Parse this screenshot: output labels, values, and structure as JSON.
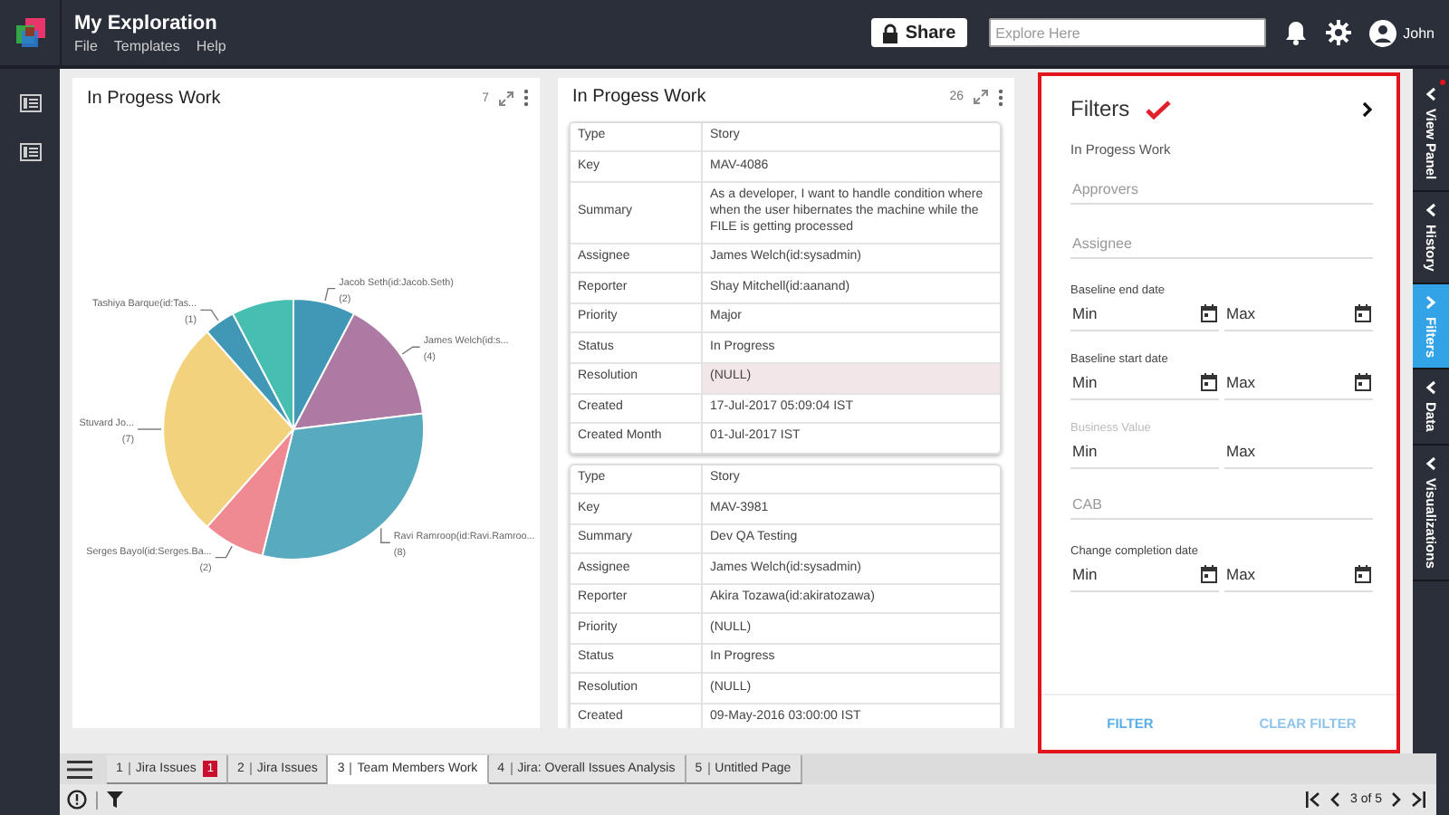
{
  "app": {
    "title": "My Exploration",
    "menu": [
      "File",
      "Templates",
      "Help"
    ],
    "share_button": "Share",
    "search": {
      "placeholder": "Explore Here"
    },
    "user": "John"
  },
  "chart_panel": {
    "title": "In Progess Work",
    "count": "7",
    "chart_data": {
      "type": "pie",
      "categories": [
        "Jacob Seth(id:Jacob.Seth)",
        "James Welch(id:s...",
        "Ravi Ramroop(id:Ravi.Ramroo...",
        "Serges Bayol(id:Serges.Ba...",
        "Stuvard Jo...",
        "Tashiya Barque(id:Tas...",
        null
      ],
      "values": [
        2,
        4,
        8,
        2,
        7,
        1,
        2
      ],
      "value_labels": [
        "(2)",
        "(4)",
        "(8)",
        "(2)",
        "(7)",
        "(1)",
        null
      ],
      "colors": [
        "#4198b6",
        "#ad7aa3",
        "#58aabf",
        "#ef8a93",
        "#f2d27d",
        "#4198b6",
        "#47bfb0"
      ]
    }
  },
  "table_panel": {
    "title": "In Progess Work",
    "count": "26",
    "records": [
      {
        "rows": [
          {
            "field": "Type",
            "value": "Story",
            "highlighted": false
          },
          {
            "field": "Key",
            "value": "MAV-4086",
            "highlighted": false
          },
          {
            "field": "Summary",
            "value": "As a developer, I want to handle condition where when the user hibernates the machine while the FILE is getting processed",
            "highlighted": false
          },
          {
            "field": "Assignee",
            "value": "James Welch(id:sysadmin)",
            "highlighted": false
          },
          {
            "field": "Reporter",
            "value": "Shay Mitchell(id:aanand)",
            "highlighted": false
          },
          {
            "field": "Priority",
            "value": "Major",
            "highlighted": false
          },
          {
            "field": "Status",
            "value": "In Progress",
            "highlighted": false
          },
          {
            "field": "Resolution",
            "value": "(NULL)",
            "highlighted": true
          },
          {
            "field": "Created",
            "value": "17-Jul-2017 05:09:04 IST",
            "highlighted": false
          },
          {
            "field": "Created Month",
            "value": "01-Jul-2017 IST",
            "highlighted": false
          }
        ]
      },
      {
        "rows": [
          {
            "field": "Type",
            "value": "Story",
            "highlighted": false
          },
          {
            "field": "Key",
            "value": "MAV-3981",
            "highlighted": false
          },
          {
            "field": "Summary",
            "value": "Dev QA Testing",
            "highlighted": false
          },
          {
            "field": "Assignee",
            "value": "James Welch(id:sysadmin)",
            "highlighted": false
          },
          {
            "field": "Reporter",
            "value": "Akira Tozawa(id:akiratozawa)",
            "highlighted": false
          },
          {
            "field": "Priority",
            "value": "(NULL)",
            "highlighted": false
          },
          {
            "field": "Status",
            "value": "In Progress",
            "highlighted": false
          },
          {
            "field": "Resolution",
            "value": "(NULL)",
            "highlighted": false
          },
          {
            "field": "Created",
            "value": "09-May-2016 03:00:00 IST",
            "highlighted": false
          }
        ]
      }
    ]
  },
  "filters": {
    "title": "Filters",
    "subtitle": "In Progess Work",
    "fields": [
      {
        "kind": "text",
        "placeholder": "Approvers"
      },
      {
        "kind": "text",
        "placeholder": "Assignee"
      },
      {
        "kind": "date_range",
        "label": "Baseline end date",
        "disabled": false,
        "min_placeholder": "Min",
        "max_placeholder": "Max"
      },
      {
        "kind": "date_range",
        "label": "Baseline start date",
        "disabled": false,
        "min_placeholder": "Min",
        "max_placeholder": "Max"
      },
      {
        "kind": "number_range",
        "label": "Business Value",
        "disabled": true,
        "min_placeholder": "Min",
        "max_placeholder": "Max"
      },
      {
        "kind": "text",
        "placeholder": "CAB"
      },
      {
        "kind": "date_range",
        "label": "Change completion date",
        "disabled": false,
        "min_placeholder": "Min",
        "max_placeholder": "Max"
      }
    ],
    "buttons": [
      {
        "label": "FILTER",
        "disabled": false
      },
      {
        "label": "CLEAR FILTER",
        "disabled": true
      }
    ]
  },
  "side_tabs": [
    {
      "label": "View Panel",
      "selected": false,
      "notification": true
    },
    {
      "label": "History",
      "selected": false,
      "notification": false
    },
    {
      "label": "Filters",
      "selected": true,
      "notification": false
    },
    {
      "label": "Data",
      "selected": false,
      "notification": false
    },
    {
      "label": "Visualizations",
      "selected": false,
      "notification": false
    }
  ],
  "page_tabs": [
    {
      "number": "1",
      "label": "Jira Issues",
      "badge": "1",
      "selected": false
    },
    {
      "number": "2",
      "label": "Jira Issues",
      "selected": false
    },
    {
      "number": "3",
      "label": "Team Members Work",
      "selected": true
    },
    {
      "number": "4",
      "label": "Jira: Overall Issues Analysis",
      "selected": false
    },
    {
      "number": "5",
      "label": "Untitled Page",
      "selected": false
    }
  ],
  "pager": "3 of 5"
}
